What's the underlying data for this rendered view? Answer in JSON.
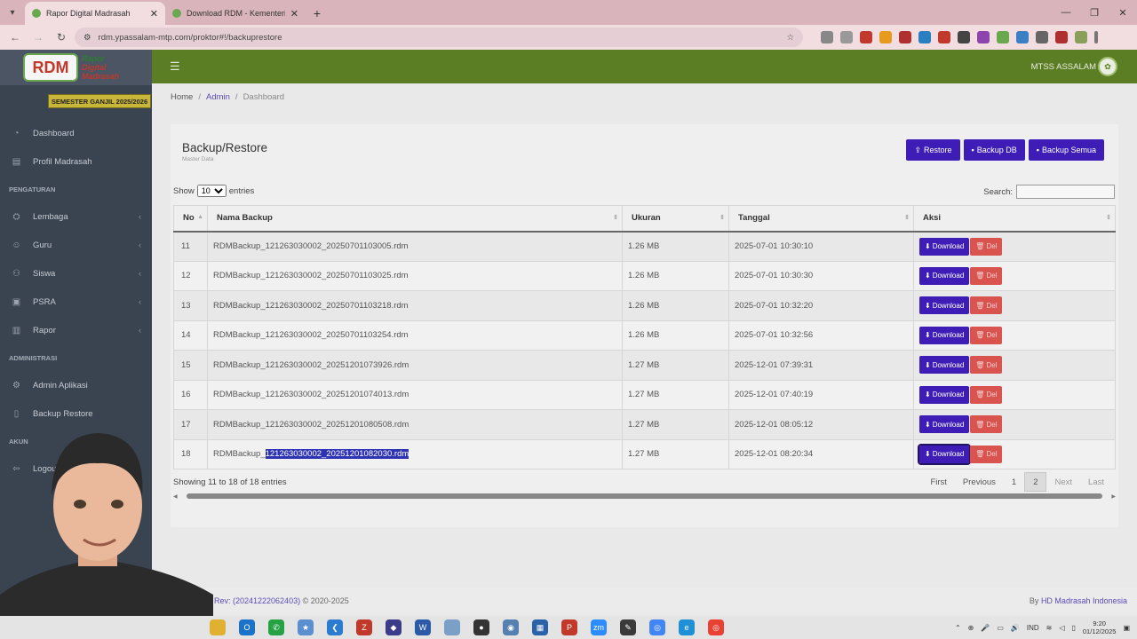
{
  "browser": {
    "tabs": [
      {
        "title": "Rapor Digital Madrasah",
        "active": true
      },
      {
        "title": "Download RDM - Kementerian",
        "active": false
      }
    ],
    "url": "rdm.ypassalam-mtp.com/proktor#!/backuprestore"
  },
  "brand": {
    "line1": "Rapor",
    "line2": "Digital",
    "line3": "Madrasah",
    "semester": "SEMESTER GANJIL 2025/2026"
  },
  "sidebar": {
    "items_top": [
      {
        "label": "Dashboard",
        "icon": "dashboard-icon"
      },
      {
        "label": "Profil Madrasah",
        "icon": "building-icon"
      }
    ],
    "section_pengaturan": "PENGATURAN",
    "items_pengaturan": [
      {
        "label": "Lembaga",
        "icon": "sitemap-icon"
      },
      {
        "label": "Guru",
        "icon": "user-icon"
      },
      {
        "label": "Siswa",
        "icon": "users-icon"
      },
      {
        "label": "PSRA",
        "icon": "book-icon"
      },
      {
        "label": "Rapor",
        "icon": "report-icon"
      }
    ],
    "section_admin": "ADMINISTRASI",
    "items_admin": [
      {
        "label": "Admin Aplikasi",
        "icon": "users-cog-icon"
      },
      {
        "label": "Backup Restore",
        "icon": "file-icon"
      }
    ],
    "section_akun": "AKUN",
    "item_logout": "Logout"
  },
  "header": {
    "school": "MTSS ASSALAM"
  },
  "breadcrumb": {
    "home": "Home",
    "admin": "Admin",
    "current": "Dashboard"
  },
  "card": {
    "title": "Backup/Restore",
    "subtitle": "Master Data",
    "buttons": {
      "restore": "Restore",
      "backup_db": "Backup DB",
      "backup_all": "Backup Semua"
    },
    "show_label": "Show",
    "show_value": "10",
    "entries_label": "entries",
    "search_label": "Search:"
  },
  "table": {
    "headers": [
      "No",
      "Nama Backup",
      "Ukuran",
      "Tanggal",
      "Aksi"
    ],
    "download_label": "Download",
    "del_label": "Del",
    "rows": [
      {
        "no": "11",
        "name": "RDMBackup_121263030002_20250701103005.rdm",
        "size": "1.26 MB",
        "date": "2025-07-01 10:30:10"
      },
      {
        "no": "12",
        "name": "RDMBackup_121263030002_20250701103025.rdm",
        "size": "1.26 MB",
        "date": "2025-07-01 10:30:30"
      },
      {
        "no": "13",
        "name": "RDMBackup_121263030002_20250701103218.rdm",
        "size": "1.26 MB",
        "date": "2025-07-01 10:32:20"
      },
      {
        "no": "14",
        "name": "RDMBackup_121263030002_20250701103254.rdm",
        "size": "1.26 MB",
        "date": "2025-07-01 10:32:56"
      },
      {
        "no": "15",
        "name": "RDMBackup_121263030002_20251201073926.rdm",
        "size": "1.27 MB",
        "date": "2025-12-01 07:39:31"
      },
      {
        "no": "16",
        "name": "RDMBackup_121263030002_20251201074013.rdm",
        "size": "1.27 MB",
        "date": "2025-12-01 07:40:19"
      },
      {
        "no": "17",
        "name": "RDMBackup_121263030002_20251201080508.rdm",
        "size": "1.27 MB",
        "date": "2025-12-01 08:05:12"
      },
      {
        "no": "18",
        "name_prefix": "RDMBackup_",
        "name_selected": "121263030002_20251201082030.rdm",
        "size": "1.27 MB",
        "date": "2025-12-01 08:20:34"
      }
    ],
    "info": "Showing 11 to 18 of 18 entries",
    "pager": {
      "first": "First",
      "previous": "Previous",
      "p1": "1",
      "p2": "2",
      "next": "Next",
      "last": "Last"
    }
  },
  "footer": {
    "rev": "Rev: (20241222062403)",
    "copy": "© 2020-2025",
    "by": "By",
    "org": "HD Madrasah Indonesia"
  },
  "taskbar": {
    "lang": "IND",
    "time": "9:20",
    "date": "01/12/2025"
  },
  "colors": {
    "primary": "#3d1db5",
    "topbar": "#5b7d24",
    "sidebar": "#3a4451",
    "danger": "#d9534f"
  }
}
